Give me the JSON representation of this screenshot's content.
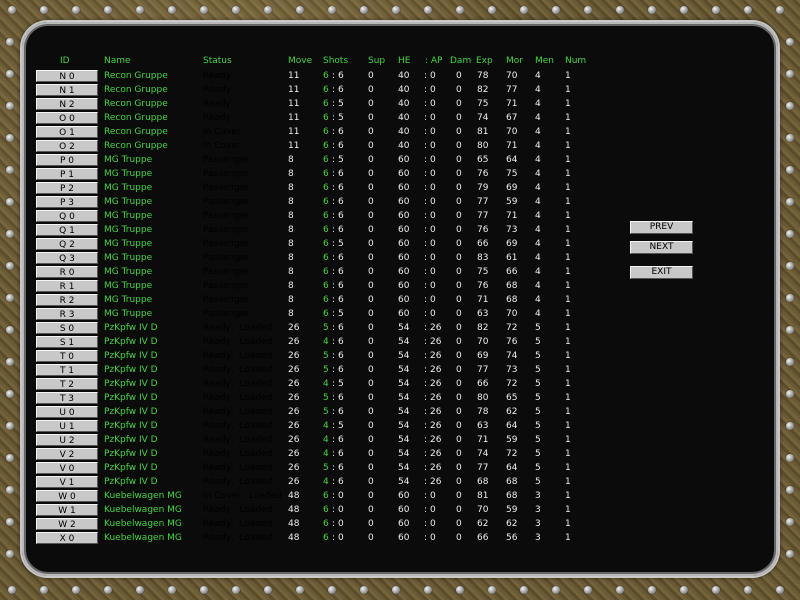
{
  "headers": {
    "id": "ID",
    "name": "Name",
    "status": "Status",
    "move": "Move",
    "shots": "Shots",
    "sup": "Sup",
    "he": "HE",
    "ap": ": AP",
    "dam": "Dam",
    "exp": "Exp",
    "mor": "Mor",
    "men": "Men",
    "num": "Num"
  },
  "buttons": {
    "prev": "PREV",
    "next": "NEXT",
    "exit": "EXIT"
  },
  "units": [
    {
      "id": "N 0",
      "name": "Recon Gruppe",
      "status": "Ready",
      "move": "11",
      "shots_a": "6",
      "shots_b": "6",
      "sup": "0",
      "he": "40",
      "ap": "0",
      "dam": "0",
      "exp": "78",
      "mor": "70",
      "men": "4",
      "num": "1"
    },
    {
      "id": "N 1",
      "name": "Recon Gruppe",
      "status": "Ready",
      "move": "11",
      "shots_a": "6",
      "shots_b": "6",
      "sup": "0",
      "he": "40",
      "ap": "0",
      "dam": "0",
      "exp": "82",
      "mor": "77",
      "men": "4",
      "num": "1"
    },
    {
      "id": "N 2",
      "name": "Recon Gruppe",
      "status": "Ready",
      "move": "11",
      "shots_a": "6",
      "shots_b": "5",
      "sup": "0",
      "he": "40",
      "ap": "0",
      "dam": "0",
      "exp": "75",
      "mor": "71",
      "men": "4",
      "num": "1"
    },
    {
      "id": "O 0",
      "name": "Recon Gruppe",
      "status": "Ready",
      "move": "11",
      "shots_a": "6",
      "shots_b": "5",
      "sup": "0",
      "he": "40",
      "ap": "0",
      "dam": "0",
      "exp": "74",
      "mor": "67",
      "men": "4",
      "num": "1"
    },
    {
      "id": "O 1",
      "name": "Recon Gruppe",
      "status": "In Cover",
      "move": "11",
      "shots_a": "6",
      "shots_b": "6",
      "sup": "0",
      "he": "40",
      "ap": "0",
      "dam": "0",
      "exp": "81",
      "mor": "70",
      "men": "4",
      "num": "1"
    },
    {
      "id": "O 2",
      "name": "Recon Gruppe",
      "status": "In Cover",
      "move": "11",
      "shots_a": "6",
      "shots_b": "6",
      "sup": "0",
      "he": "40",
      "ap": "0",
      "dam": "0",
      "exp": "80",
      "mor": "71",
      "men": "4",
      "num": "1"
    },
    {
      "id": "P 0",
      "name": "MG Truppe",
      "status": "Passenger",
      "move": "8",
      "shots_a": "6",
      "shots_b": "5",
      "sup": "0",
      "he": "60",
      "ap": "0",
      "dam": "0",
      "exp": "65",
      "mor": "64",
      "men": "4",
      "num": "1"
    },
    {
      "id": "P 1",
      "name": "MG Truppe",
      "status": "Passenger",
      "move": "8",
      "shots_a": "6",
      "shots_b": "6",
      "sup": "0",
      "he": "60",
      "ap": "0",
      "dam": "0",
      "exp": "76",
      "mor": "75",
      "men": "4",
      "num": "1"
    },
    {
      "id": "P 2",
      "name": "MG Truppe",
      "status": "Passenger",
      "move": "8",
      "shots_a": "6",
      "shots_b": "6",
      "sup": "0",
      "he": "60",
      "ap": "0",
      "dam": "0",
      "exp": "79",
      "mor": "69",
      "men": "4",
      "num": "1"
    },
    {
      "id": "P 3",
      "name": "MG Truppe",
      "status": "Passenger",
      "move": "8",
      "shots_a": "6",
      "shots_b": "6",
      "sup": "0",
      "he": "60",
      "ap": "0",
      "dam": "0",
      "exp": "77",
      "mor": "59",
      "men": "4",
      "num": "1"
    },
    {
      "id": "Q 0",
      "name": "MG Truppe",
      "status": "Passenger",
      "move": "8",
      "shots_a": "6",
      "shots_b": "6",
      "sup": "0",
      "he": "60",
      "ap": "0",
      "dam": "0",
      "exp": "77",
      "mor": "71",
      "men": "4",
      "num": "1"
    },
    {
      "id": "Q 1",
      "name": "MG Truppe",
      "status": "Passenger",
      "move": "8",
      "shots_a": "6",
      "shots_b": "6",
      "sup": "0",
      "he": "60",
      "ap": "0",
      "dam": "0",
      "exp": "76",
      "mor": "73",
      "men": "4",
      "num": "1"
    },
    {
      "id": "Q 2",
      "name": "MG Truppe",
      "status": "Passenger",
      "move": "8",
      "shots_a": "6",
      "shots_b": "5",
      "sup": "0",
      "he": "60",
      "ap": "0",
      "dam": "0",
      "exp": "66",
      "mor": "69",
      "men": "4",
      "num": "1"
    },
    {
      "id": "Q 3",
      "name": "MG Truppe",
      "status": "Passenger",
      "move": "8",
      "shots_a": "6",
      "shots_b": "6",
      "sup": "0",
      "he": "60",
      "ap": "0",
      "dam": "0",
      "exp": "83",
      "mor": "61",
      "men": "4",
      "num": "1"
    },
    {
      "id": "R 0",
      "name": "MG Truppe",
      "status": "Passenger",
      "move": "8",
      "shots_a": "6",
      "shots_b": "6",
      "sup": "0",
      "he": "60",
      "ap": "0",
      "dam": "0",
      "exp": "75",
      "mor": "66",
      "men": "4",
      "num": "1"
    },
    {
      "id": "R 1",
      "name": "MG Truppe",
      "status": "Passenger",
      "move": "8",
      "shots_a": "6",
      "shots_b": "6",
      "sup": "0",
      "he": "60",
      "ap": "0",
      "dam": "0",
      "exp": "76",
      "mor": "68",
      "men": "4",
      "num": "1"
    },
    {
      "id": "R 2",
      "name": "MG Truppe",
      "status": "Passenger",
      "move": "8",
      "shots_a": "6",
      "shots_b": "6",
      "sup": "0",
      "he": "60",
      "ap": "0",
      "dam": "0",
      "exp": "71",
      "mor": "68",
      "men": "4",
      "num": "1"
    },
    {
      "id": "R 3",
      "name": "MG Truppe",
      "status": "Passenger",
      "move": "8",
      "shots_a": "6",
      "shots_b": "5",
      "sup": "0",
      "he": "60",
      "ap": "0",
      "dam": "0",
      "exp": "63",
      "mor": "70",
      "men": "4",
      "num": "1"
    },
    {
      "id": "S 0",
      "name": "PzKpfw IV D",
      "status": "Ready,  Loaded",
      "move": "26",
      "shots_a": "5",
      "shots_b": "6",
      "sup": "0",
      "he": "54",
      "ap": "26",
      "dam": "0",
      "exp": "82",
      "mor": "72",
      "men": "5",
      "num": "1"
    },
    {
      "id": "S 1",
      "name": "PzKpfw IV D",
      "status": "Ready,  Loaded",
      "move": "26",
      "shots_a": "4",
      "shots_b": "6",
      "sup": "0",
      "he": "54",
      "ap": "26",
      "dam": "0",
      "exp": "70",
      "mor": "76",
      "men": "5",
      "num": "1"
    },
    {
      "id": "T 0",
      "name": "PzKpfw IV D",
      "status": "Ready,  Loaded",
      "move": "26",
      "shots_a": "5",
      "shots_b": "6",
      "sup": "0",
      "he": "54",
      "ap": "26",
      "dam": "0",
      "exp": "69",
      "mor": "74",
      "men": "5",
      "num": "1"
    },
    {
      "id": "T 1",
      "name": "PzKpfw IV D",
      "status": "Ready,  Loaded",
      "move": "26",
      "shots_a": "5",
      "shots_b": "6",
      "sup": "0",
      "he": "54",
      "ap": "26",
      "dam": "0",
      "exp": "77",
      "mor": "73",
      "men": "5",
      "num": "1"
    },
    {
      "id": "T 2",
      "name": "PzKpfw IV D",
      "status": "Ready,  Loaded",
      "move": "26",
      "shots_a": "4",
      "shots_b": "5",
      "sup": "0",
      "he": "54",
      "ap": "26",
      "dam": "0",
      "exp": "66",
      "mor": "72",
      "men": "5",
      "num": "1"
    },
    {
      "id": "T 3",
      "name": "PzKpfw IV D",
      "status": "Ready,  Loaded",
      "move": "26",
      "shots_a": "5",
      "shots_b": "6",
      "sup": "0",
      "he": "54",
      "ap": "26",
      "dam": "0",
      "exp": "80",
      "mor": "65",
      "men": "5",
      "num": "1"
    },
    {
      "id": "U 0",
      "name": "PzKpfw IV D",
      "status": "Ready,  Loaded",
      "move": "26",
      "shots_a": "5",
      "shots_b": "6",
      "sup": "0",
      "he": "54",
      "ap": "26",
      "dam": "0",
      "exp": "78",
      "mor": "62",
      "men": "5",
      "num": "1"
    },
    {
      "id": "U 1",
      "name": "PzKpfw IV D",
      "status": "Ready,  Loaded",
      "move": "26",
      "shots_a": "4",
      "shots_b": "5",
      "sup": "0",
      "he": "54",
      "ap": "26",
      "dam": "0",
      "exp": "63",
      "mor": "64",
      "men": "5",
      "num": "1"
    },
    {
      "id": "U 2",
      "name": "PzKpfw IV D",
      "status": "Ready,  Loaded",
      "move": "26",
      "shots_a": "4",
      "shots_b": "6",
      "sup": "0",
      "he": "54",
      "ap": "26",
      "dam": "0",
      "exp": "71",
      "mor": "59",
      "men": "5",
      "num": "1"
    },
    {
      "id": "V 2",
      "name": "PzKpfw IV D",
      "status": "Ready,  Loaded",
      "move": "26",
      "shots_a": "4",
      "shots_b": "6",
      "sup": "0",
      "he": "54",
      "ap": "26",
      "dam": "0",
      "exp": "74",
      "mor": "72",
      "men": "5",
      "num": "1"
    },
    {
      "id": "V 0",
      "name": "PzKpfw IV D",
      "status": "Ready,  Loaded",
      "move": "26",
      "shots_a": "5",
      "shots_b": "6",
      "sup": "0",
      "he": "54",
      "ap": "26",
      "dam": "0",
      "exp": "77",
      "mor": "64",
      "men": "5",
      "num": "1"
    },
    {
      "id": "V 1",
      "name": "PzKpfw IV D",
      "status": "Ready,  Loaded",
      "move": "26",
      "shots_a": "4",
      "shots_b": "6",
      "sup": "0",
      "he": "54",
      "ap": "26",
      "dam": "0",
      "exp": "68",
      "mor": "68",
      "men": "5",
      "num": "1"
    },
    {
      "id": "W 0",
      "name": "Kuebelwagen MG",
      "status": "In Cover,  Loaded",
      "move": "48",
      "shots_a": "6",
      "shots_b": "0",
      "sup": "0",
      "he": "60",
      "ap": "0",
      "dam": "0",
      "exp": "81",
      "mor": "68",
      "men": "3",
      "num": "1"
    },
    {
      "id": "W 1",
      "name": "Kuebelwagen MG",
      "status": "Ready,  Loaded",
      "move": "48",
      "shots_a": "6",
      "shots_b": "0",
      "sup": "0",
      "he": "60",
      "ap": "0",
      "dam": "0",
      "exp": "70",
      "mor": "59",
      "men": "3",
      "num": "1"
    },
    {
      "id": "W 2",
      "name": "Kuebelwagen MG",
      "status": "Ready,  Loaded",
      "move": "48",
      "shots_a": "6",
      "shots_b": "0",
      "sup": "0",
      "he": "60",
      "ap": "0",
      "dam": "0",
      "exp": "62",
      "mor": "62",
      "men": "3",
      "num": "1"
    },
    {
      "id": "X 0",
      "name": "Kuebelwagen MG",
      "status": "Ready,  Loaded",
      "move": "48",
      "shots_a": "6",
      "shots_b": "0",
      "sup": "0",
      "he": "60",
      "ap": "0",
      "dam": "0",
      "exp": "66",
      "mor": "56",
      "men": "3",
      "num": "1"
    }
  ]
}
